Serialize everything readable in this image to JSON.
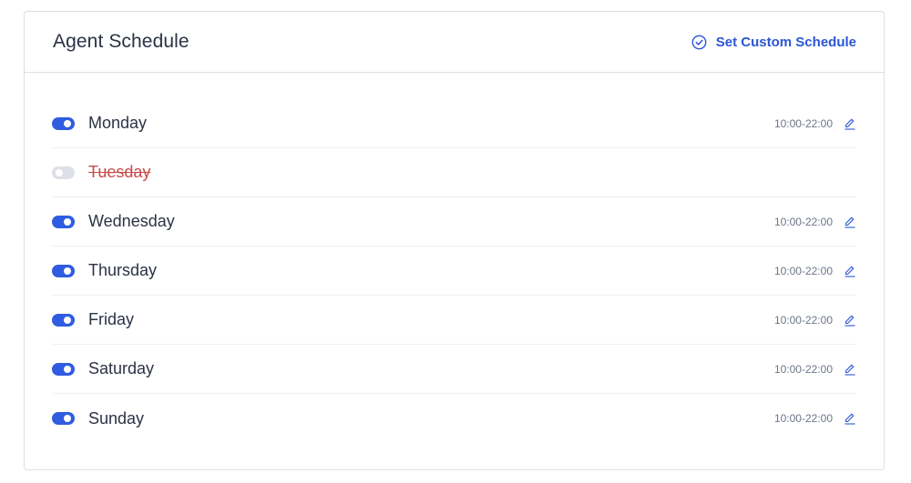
{
  "header": {
    "title": "Agent Schedule",
    "custom_link_label": "Set Custom Schedule",
    "custom_link_icon": "check-circle-icon"
  },
  "colors": {
    "accent": "#2f5ce0",
    "disabled_text": "#c84b4b",
    "toggle_off": "#dde0e6"
  },
  "days": [
    {
      "label": "Monday",
      "enabled": true,
      "hours": "10:00-22:00"
    },
    {
      "label": "Tuesday",
      "enabled": false,
      "hours": ""
    },
    {
      "label": "Wednesday",
      "enabled": true,
      "hours": "10:00-22:00"
    },
    {
      "label": "Thursday",
      "enabled": true,
      "hours": "10:00-22:00"
    },
    {
      "label": "Friday",
      "enabled": true,
      "hours": "10:00-22:00"
    },
    {
      "label": "Saturday",
      "enabled": true,
      "hours": "10:00-22:00"
    },
    {
      "label": "Sunday",
      "enabled": true,
      "hours": "10:00-22:00"
    }
  ]
}
